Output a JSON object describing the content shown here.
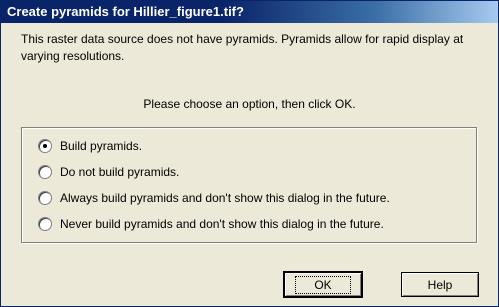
{
  "dialog": {
    "title": "Create pyramids for Hillier_figure1.tif?",
    "description": "This raster data source does not have pyramids. Pyramids allow for rapid display at varying resolutions.",
    "prompt": "Please choose an option, then click OK.",
    "options": [
      {
        "label": "Build pyramids.",
        "checked": true
      },
      {
        "label": "Do not build pyramids.",
        "checked": false
      },
      {
        "label": "Always build pyramids and don't show this dialog in the future.",
        "checked": false
      },
      {
        "label": "Never build pyramids and don't show this dialog in the future.",
        "checked": false
      }
    ],
    "ok_label": "OK",
    "help_label": "Help"
  }
}
